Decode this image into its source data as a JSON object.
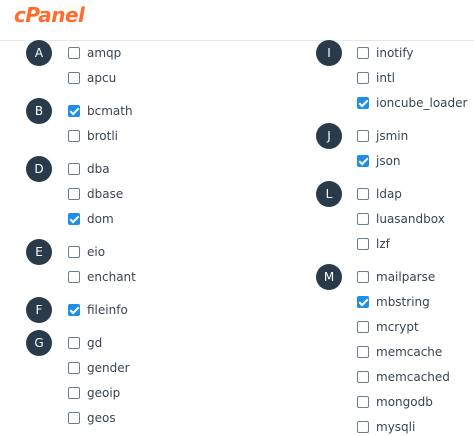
{
  "header": {
    "logo_text": "cPanel",
    "brand_color": "#ff6c2c"
  },
  "colors": {
    "letter_badge": "#293a4a",
    "checkbox_checked": "#1f8ee6",
    "checkbox_border": "#6b7d8e",
    "text": "#3a4550"
  },
  "left_groups": [
    {
      "letter": "A",
      "options": [
        {
          "label": "amqp",
          "checked": false
        },
        {
          "label": "apcu",
          "checked": false
        }
      ]
    },
    {
      "letter": "B",
      "options": [
        {
          "label": "bcmath",
          "checked": true
        },
        {
          "label": "brotli",
          "checked": false
        }
      ]
    },
    {
      "letter": "D",
      "options": [
        {
          "label": "dba",
          "checked": false
        },
        {
          "label": "dbase",
          "checked": false
        },
        {
          "label": "dom",
          "checked": true
        }
      ]
    },
    {
      "letter": "E",
      "options": [
        {
          "label": "eio",
          "checked": false
        },
        {
          "label": "enchant",
          "checked": false
        }
      ]
    },
    {
      "letter": "F",
      "options": [
        {
          "label": "fileinfo",
          "checked": true
        }
      ]
    },
    {
      "letter": "G",
      "options": [
        {
          "label": "gd",
          "checked": false
        },
        {
          "label": "gender",
          "checked": false
        },
        {
          "label": "geoip",
          "checked": false
        },
        {
          "label": "geos",
          "checked": false
        }
      ]
    }
  ],
  "right_groups": [
    {
      "letter": "I",
      "options": [
        {
          "label": "inotify",
          "checked": false
        },
        {
          "label": "intl",
          "checked": false
        },
        {
          "label": "ioncube_loader",
          "checked": true
        }
      ]
    },
    {
      "letter": "J",
      "options": [
        {
          "label": "jsmin",
          "checked": false
        },
        {
          "label": "json",
          "checked": true
        }
      ]
    },
    {
      "letter": "L",
      "options": [
        {
          "label": "ldap",
          "checked": false
        },
        {
          "label": "luasandbox",
          "checked": false
        },
        {
          "label": "lzf",
          "checked": false
        }
      ]
    },
    {
      "letter": "M",
      "options": [
        {
          "label": "mailparse",
          "checked": false
        },
        {
          "label": "mbstring",
          "checked": true
        },
        {
          "label": "mcrypt",
          "checked": false
        },
        {
          "label": "memcache",
          "checked": false
        },
        {
          "label": "memcached",
          "checked": false
        },
        {
          "label": "mongodb",
          "checked": false
        },
        {
          "label": "mysqli",
          "checked": false
        }
      ]
    }
  ]
}
